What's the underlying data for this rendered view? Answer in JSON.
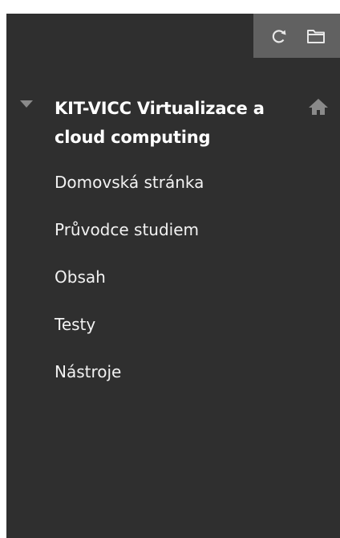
{
  "toolbar": {
    "refresh_icon": "refresh-icon",
    "folder_icon": "folder-icon"
  },
  "course": {
    "title": "KIT-VICC Virtualizace a cloud computing",
    "home_icon": "home-icon"
  },
  "menu": {
    "items": [
      {
        "label": "Domovská stránka"
      },
      {
        "label": "Průvodce studiem"
      },
      {
        "label": "Obsah"
      },
      {
        "label": "Testy"
      },
      {
        "label": "Nástroje"
      }
    ]
  },
  "colors": {
    "sidebar_bg": "#2f2f2f",
    "toolbar_bg": "#616161",
    "text": "#ffffff",
    "icon_grey": "#8a8a8a"
  }
}
